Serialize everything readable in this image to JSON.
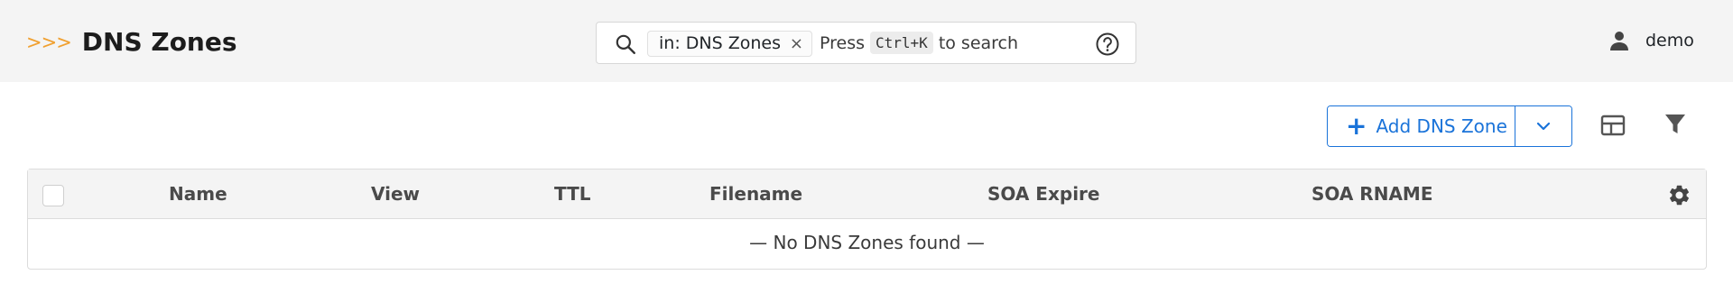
{
  "header": {
    "title": "DNS Zones",
    "chevrons": ">>>"
  },
  "search": {
    "scope_chip": "in: DNS Zones",
    "chip_close": "×",
    "hint_before": "Press",
    "shortcut": "Ctrl+K",
    "hint_after": "to search"
  },
  "user": {
    "name": "demo"
  },
  "toolbar": {
    "add_label": "Add DNS Zone",
    "add_icon": "+"
  },
  "table": {
    "columns": [
      "Name",
      "View",
      "TTL",
      "Filename",
      "SOA Expire",
      "SOA RNAME"
    ],
    "empty_message": "— No DNS Zones found —"
  },
  "colors": {
    "accent": "#1a73d9",
    "brand_chevrons": "#f0a030",
    "topbar_bg": "#f4f4f4"
  }
}
